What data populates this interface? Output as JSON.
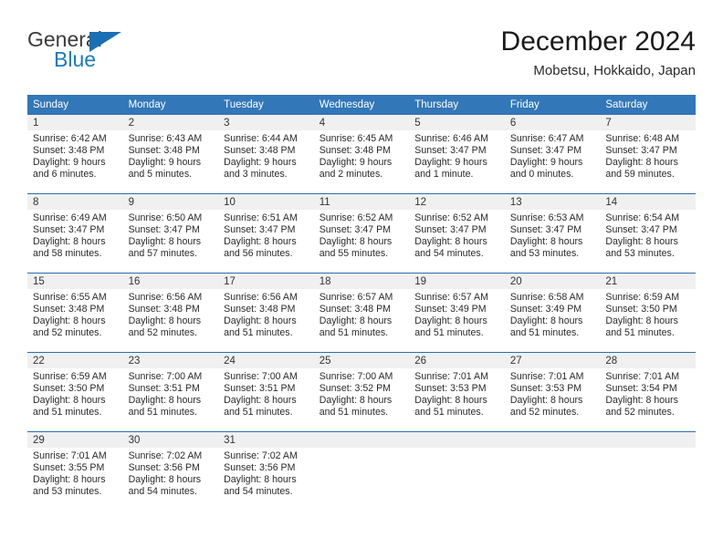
{
  "brand": {
    "name_part1": "General",
    "name_part2": "Blue"
  },
  "header": {
    "title": "December 2024",
    "location": "Mobetsu, Hokkaido, Japan"
  },
  "colors": {
    "header_blue": "#3277b8",
    "separator_blue": "#2c6ead",
    "daynum_strip": "#f0f0f0",
    "logo_blue": "#1b79c4"
  },
  "weekday_headers": [
    "Sunday",
    "Monday",
    "Tuesday",
    "Wednesday",
    "Thursday",
    "Friday",
    "Saturday"
  ],
  "weeks": [
    [
      {
        "day": "1",
        "sunrise": "Sunrise: 6:42 AM",
        "sunset": "Sunset: 3:48 PM",
        "daylight_line1": "Daylight: 9 hours",
        "daylight_line2": "and 6 minutes."
      },
      {
        "day": "2",
        "sunrise": "Sunrise: 6:43 AM",
        "sunset": "Sunset: 3:48 PM",
        "daylight_line1": "Daylight: 9 hours",
        "daylight_line2": "and 5 minutes."
      },
      {
        "day": "3",
        "sunrise": "Sunrise: 6:44 AM",
        "sunset": "Sunset: 3:48 PM",
        "daylight_line1": "Daylight: 9 hours",
        "daylight_line2": "and 3 minutes."
      },
      {
        "day": "4",
        "sunrise": "Sunrise: 6:45 AM",
        "sunset": "Sunset: 3:48 PM",
        "daylight_line1": "Daylight: 9 hours",
        "daylight_line2": "and 2 minutes."
      },
      {
        "day": "5",
        "sunrise": "Sunrise: 6:46 AM",
        "sunset": "Sunset: 3:47 PM",
        "daylight_line1": "Daylight: 9 hours",
        "daylight_line2": "and 1 minute."
      },
      {
        "day": "6",
        "sunrise": "Sunrise: 6:47 AM",
        "sunset": "Sunset: 3:47 PM",
        "daylight_line1": "Daylight: 9 hours",
        "daylight_line2": "and 0 minutes."
      },
      {
        "day": "7",
        "sunrise": "Sunrise: 6:48 AM",
        "sunset": "Sunset: 3:47 PM",
        "daylight_line1": "Daylight: 8 hours",
        "daylight_line2": "and 59 minutes."
      }
    ],
    [
      {
        "day": "8",
        "sunrise": "Sunrise: 6:49 AM",
        "sunset": "Sunset: 3:47 PM",
        "daylight_line1": "Daylight: 8 hours",
        "daylight_line2": "and 58 minutes."
      },
      {
        "day": "9",
        "sunrise": "Sunrise: 6:50 AM",
        "sunset": "Sunset: 3:47 PM",
        "daylight_line1": "Daylight: 8 hours",
        "daylight_line2": "and 57 minutes."
      },
      {
        "day": "10",
        "sunrise": "Sunrise: 6:51 AM",
        "sunset": "Sunset: 3:47 PM",
        "daylight_line1": "Daylight: 8 hours",
        "daylight_line2": "and 56 minutes."
      },
      {
        "day": "11",
        "sunrise": "Sunrise: 6:52 AM",
        "sunset": "Sunset: 3:47 PM",
        "daylight_line1": "Daylight: 8 hours",
        "daylight_line2": "and 55 minutes."
      },
      {
        "day": "12",
        "sunrise": "Sunrise: 6:52 AM",
        "sunset": "Sunset: 3:47 PM",
        "daylight_line1": "Daylight: 8 hours",
        "daylight_line2": "and 54 minutes."
      },
      {
        "day": "13",
        "sunrise": "Sunrise: 6:53 AM",
        "sunset": "Sunset: 3:47 PM",
        "daylight_line1": "Daylight: 8 hours",
        "daylight_line2": "and 53 minutes."
      },
      {
        "day": "14",
        "sunrise": "Sunrise: 6:54 AM",
        "sunset": "Sunset: 3:47 PM",
        "daylight_line1": "Daylight: 8 hours",
        "daylight_line2": "and 53 minutes."
      }
    ],
    [
      {
        "day": "15",
        "sunrise": "Sunrise: 6:55 AM",
        "sunset": "Sunset: 3:48 PM",
        "daylight_line1": "Daylight: 8 hours",
        "daylight_line2": "and 52 minutes."
      },
      {
        "day": "16",
        "sunrise": "Sunrise: 6:56 AM",
        "sunset": "Sunset: 3:48 PM",
        "daylight_line1": "Daylight: 8 hours",
        "daylight_line2": "and 52 minutes."
      },
      {
        "day": "17",
        "sunrise": "Sunrise: 6:56 AM",
        "sunset": "Sunset: 3:48 PM",
        "daylight_line1": "Daylight: 8 hours",
        "daylight_line2": "and 51 minutes."
      },
      {
        "day": "18",
        "sunrise": "Sunrise: 6:57 AM",
        "sunset": "Sunset: 3:48 PM",
        "daylight_line1": "Daylight: 8 hours",
        "daylight_line2": "and 51 minutes."
      },
      {
        "day": "19",
        "sunrise": "Sunrise: 6:57 AM",
        "sunset": "Sunset: 3:49 PM",
        "daylight_line1": "Daylight: 8 hours",
        "daylight_line2": "and 51 minutes."
      },
      {
        "day": "20",
        "sunrise": "Sunrise: 6:58 AM",
        "sunset": "Sunset: 3:49 PM",
        "daylight_line1": "Daylight: 8 hours",
        "daylight_line2": "and 51 minutes."
      },
      {
        "day": "21",
        "sunrise": "Sunrise: 6:59 AM",
        "sunset": "Sunset: 3:50 PM",
        "daylight_line1": "Daylight: 8 hours",
        "daylight_line2": "and 51 minutes."
      }
    ],
    [
      {
        "day": "22",
        "sunrise": "Sunrise: 6:59 AM",
        "sunset": "Sunset: 3:50 PM",
        "daylight_line1": "Daylight: 8 hours",
        "daylight_line2": "and 51 minutes."
      },
      {
        "day": "23",
        "sunrise": "Sunrise: 7:00 AM",
        "sunset": "Sunset: 3:51 PM",
        "daylight_line1": "Daylight: 8 hours",
        "daylight_line2": "and 51 minutes."
      },
      {
        "day": "24",
        "sunrise": "Sunrise: 7:00 AM",
        "sunset": "Sunset: 3:51 PM",
        "daylight_line1": "Daylight: 8 hours",
        "daylight_line2": "and 51 minutes."
      },
      {
        "day": "25",
        "sunrise": "Sunrise: 7:00 AM",
        "sunset": "Sunset: 3:52 PM",
        "daylight_line1": "Daylight: 8 hours",
        "daylight_line2": "and 51 minutes."
      },
      {
        "day": "26",
        "sunrise": "Sunrise: 7:01 AM",
        "sunset": "Sunset: 3:53 PM",
        "daylight_line1": "Daylight: 8 hours",
        "daylight_line2": "and 51 minutes."
      },
      {
        "day": "27",
        "sunrise": "Sunrise: 7:01 AM",
        "sunset": "Sunset: 3:53 PM",
        "daylight_line1": "Daylight: 8 hours",
        "daylight_line2": "and 52 minutes."
      },
      {
        "day": "28",
        "sunrise": "Sunrise: 7:01 AM",
        "sunset": "Sunset: 3:54 PM",
        "daylight_line1": "Daylight: 8 hours",
        "daylight_line2": "and 52 minutes."
      }
    ],
    [
      {
        "day": "29",
        "sunrise": "Sunrise: 7:01 AM",
        "sunset": "Sunset: 3:55 PM",
        "daylight_line1": "Daylight: 8 hours",
        "daylight_line2": "and 53 minutes."
      },
      {
        "day": "30",
        "sunrise": "Sunrise: 7:02 AM",
        "sunset": "Sunset: 3:56 PM",
        "daylight_line1": "Daylight: 8 hours",
        "daylight_line2": "and 54 minutes."
      },
      {
        "day": "31",
        "sunrise": "Sunrise: 7:02 AM",
        "sunset": "Sunset: 3:56 PM",
        "daylight_line1": "Daylight: 8 hours",
        "daylight_line2": "and 54 minutes."
      },
      {
        "day": "",
        "sunrise": "",
        "sunset": "",
        "daylight_line1": "",
        "daylight_line2": ""
      },
      {
        "day": "",
        "sunrise": "",
        "sunset": "",
        "daylight_line1": "",
        "daylight_line2": ""
      },
      {
        "day": "",
        "sunrise": "",
        "sunset": "",
        "daylight_line1": "",
        "daylight_line2": ""
      },
      {
        "day": "",
        "sunrise": "",
        "sunset": "",
        "daylight_line1": "",
        "daylight_line2": ""
      }
    ]
  ]
}
